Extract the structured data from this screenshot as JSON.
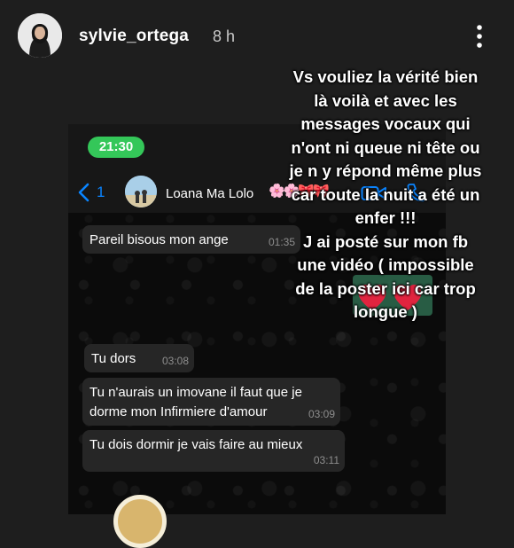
{
  "header": {
    "username": "sylvie_ortega",
    "time_ago": "8 h",
    "avatar_icon": "profile-photo",
    "more_icon": "vertical-ellipsis-icon"
  },
  "whatsapp": {
    "clock": "21:30",
    "back_count": "1",
    "contact_name": "Loana Ma Lolo",
    "contact_emoji": "🌸🌸🎀🎀",
    "accent_color": "#0a84ff",
    "clock_color": "#34c759",
    "messages": [
      {
        "text": "Pareil bisous mon ange",
        "time": "01:35"
      },
      {
        "text": "Tu dors",
        "time": "03:08"
      },
      {
        "text": "Tu n'aurais un imovane il faut que je\ndorme mon Infirmiere d'amour",
        "time": "03:09"
      },
      {
        "text": "Tu dois dormir je vais faire au mieux",
        "time": "03:11"
      }
    ]
  },
  "story_text": "Vs vouliez la vérité bien\nlà voilà et avec les\nmessages vocaux qui\nn'ont ni queue ni tête ou\nje n y répond même plus\ncar toute la nuit a été un\nenfer !!!\nJ ai posté sur mon fb\nune vidéo ( impossible\nde la poster ici car trop\nlongue )"
}
